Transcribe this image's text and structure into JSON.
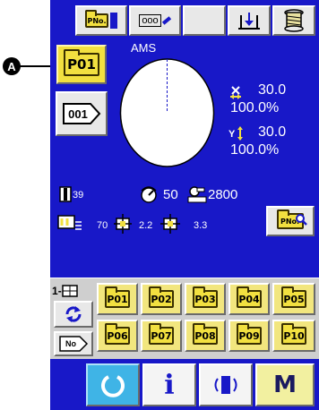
{
  "toolbar": {
    "pattern_no_icon_label": "PNo.",
    "counter_icon_label": "ooo"
  },
  "callout": {
    "marker_letter": "A"
  },
  "pattern_button": {
    "label": "P01"
  },
  "sewing_type": "AMS",
  "sequence_button": {
    "label": "001"
  },
  "dimensions": {
    "x_value": "30.0",
    "x_scale": "100.0%",
    "y_value": "30.0",
    "y_scale": "100.0%"
  },
  "status": {
    "thread_tension": "39",
    "speed": "50",
    "max_speed": "2800",
    "feed_value": "70",
    "pitch_value": "2.2",
    "stitch_length": "3.3"
  },
  "pattern_search_button": {
    "label": "PNo."
  },
  "pattern_grid": {
    "page_indicator": "1",
    "items": [
      "P01",
      "P02",
      "P03",
      "P04",
      "P05",
      "P06",
      "P07",
      "P08",
      "P09",
      "P10"
    ]
  },
  "no_button": {
    "label": "No"
  },
  "bottom_bar": {
    "mode_label": "M",
    "info_label": "i"
  }
}
